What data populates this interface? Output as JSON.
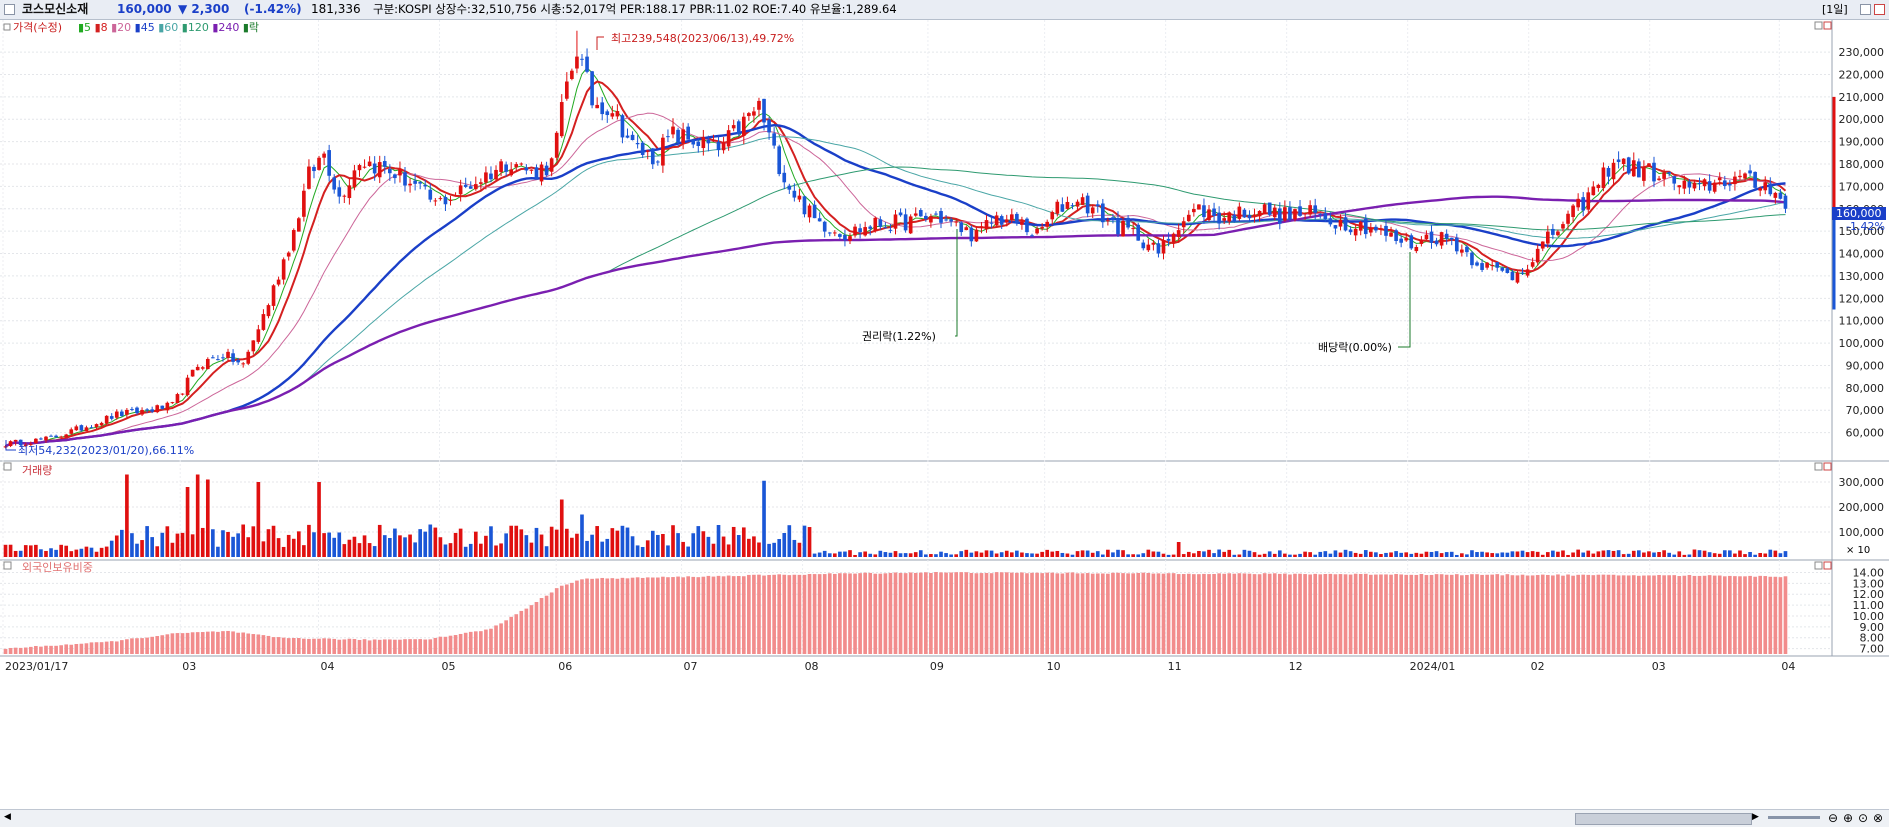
{
  "header": {
    "stock_name": "코스모신소재",
    "price": "160,000",
    "change": "▼ 2,300",
    "change_pct": "(-1.42%)",
    "volume": "181,336",
    "info": "구분:KOSPI  상장수:32,510,756  시총:52,017억  PER:188.17  PBR:11.02  ROE:7.40  유보율:1,289.64",
    "period": "[1일]"
  },
  "legend": {
    "price_label": "가격(수정)",
    "ma": [
      {
        "label": "5",
        "color": "#22aa22"
      },
      {
        "label": "8",
        "color": "#d42020"
      },
      {
        "label": "20",
        "color": "#cc6699"
      },
      {
        "label": "45",
        "color": "#1a3fc8"
      },
      {
        "label": "60",
        "color": "#4aa6a6"
      },
      {
        "label": "120",
        "color": "#2e9a70"
      },
      {
        "label": "240",
        "color": "#7a1fb0"
      }
    ],
    "extra_label": "락"
  },
  "annotations": {
    "high": "최고239,548(2023/06/13),49.72%",
    "low": "최저54,232(2023/01/20),66.11%",
    "rights": "권리락(1.22%)",
    "dividend": "배당락(0.00%)",
    "last_price": "160,000",
    "last_pct": "-1.42%"
  },
  "panels": {
    "volume_title": "거래량",
    "foreign_title": "외국인보유비중",
    "volume_unit": "× 10"
  },
  "chart_data": [
    {
      "type": "candlestick",
      "title": "가격(수정)",
      "y_ticks": [
        60000,
        70000,
        80000,
        90000,
        100000,
        110000,
        120000,
        130000,
        140000,
        150000,
        160000,
        170000,
        180000,
        190000,
        200000,
        210000,
        220000,
        230000
      ],
      "y_tick_labels": [
        "60,000",
        "70,000",
        "80,000",
        "90,000",
        "100,000",
        "110,000",
        "120,000",
        "130,000",
        "140,000",
        "150,000",
        "160,000",
        "170,000",
        "180,000",
        "190,000",
        "200,000",
        "210,000",
        "220,000",
        "230,000"
      ],
      "ylim": [
        50000,
        243000
      ],
      "x_labels": [
        "2023/01/17",
        "03",
        "04",
        "05",
        "06",
        "07",
        "08",
        "09",
        "10",
        "11",
        "12",
        "2024/01",
        "02",
        "03",
        "04"
      ],
      "ma_periods": [
        5,
        8,
        20,
        45,
        60,
        120,
        240
      ],
      "anchors": [
        [
          0,
          55000
        ],
        [
          8,
          57000
        ],
        [
          15,
          62000
        ],
        [
          22,
          68000
        ],
        [
          28,
          70000
        ],
        [
          33,
          72000
        ],
        [
          38,
          90000
        ],
        [
          43,
          95000
        ],
        [
          47,
          90000
        ],
        [
          52,
          118000
        ],
        [
          57,
          150000
        ],
        [
          60,
          175000
        ],
        [
          63,
          185000
        ],
        [
          66,
          165000
        ],
        [
          70,
          182000
        ],
        [
          75,
          178000
        ],
        [
          80,
          172000
        ],
        [
          85,
          162000
        ],
        [
          90,
          168000
        ],
        [
          95,
          175000
        ],
        [
          100,
          182000
        ],
        [
          104,
          176000
        ],
        [
          108,
          180000
        ],
        [
          111,
          215000
        ],
        [
          113,
          232000
        ],
        [
          116,
          208000
        ],
        [
          120,
          205000
        ],
        [
          124,
          188000
        ],
        [
          128,
          183000
        ],
        [
          132,
          193000
        ],
        [
          137,
          190000
        ],
        [
          141,
          186000
        ],
        [
          145,
          196000
        ],
        [
          149,
          206000
        ],
        [
          152,
          185000
        ],
        [
          155,
          170000
        ],
        [
          160,
          155000
        ],
        [
          166,
          149000
        ],
        [
          172,
          153000
        ],
        [
          178,
          154000
        ],
        [
          184,
          157000
        ],
        [
          188,
          152000
        ],
        [
          192,
          148000
        ],
        [
          196,
          156000
        ],
        [
          200,
          154000
        ],
        [
          204,
          148000
        ],
        [
          208,
          160000
        ],
        [
          212,
          165000
        ],
        [
          216,
          158000
        ],
        [
          220,
          152000
        ],
        [
          224,
          148000
        ],
        [
          228,
          140000
        ],
        [
          232,
          154000
        ],
        [
          236,
          160000
        ],
        [
          240,
          156000
        ],
        [
          244,
          158000
        ],
        [
          248,
          160000
        ],
        [
          252,
          157000
        ],
        [
          258,
          158000
        ],
        [
          264,
          154000
        ],
        [
          270,
          152000
        ],
        [
          274,
          147000
        ],
        [
          278,
          144000
        ],
        [
          282,
          148000
        ],
        [
          286,
          146000
        ],
        [
          290,
          138000
        ],
        [
          294,
          133000
        ],
        [
          298,
          130000
        ],
        [
          302,
          138000
        ],
        [
          306,
          149000
        ],
        [
          310,
          158000
        ],
        [
          314,
          168000
        ],
        [
          318,
          182000
        ],
        [
          322,
          178000
        ],
        [
          326,
          176000
        ],
        [
          330,
          172000
        ],
        [
          334,
          168000
        ],
        [
          338,
          172000
        ],
        [
          342,
          174000
        ],
        [
          346,
          171000
        ],
        [
          350,
          170000
        ],
        [
          352,
          160000
        ]
      ],
      "candle_count": 353,
      "high": 239548,
      "low": 54232,
      "last": 160000
    },
    {
      "type": "bar",
      "title": "거래량",
      "y_tick_labels": [
        "100,000",
        "200,000",
        "300,000"
      ],
      "y_ticks": [
        100000,
        200000,
        300000
      ],
      "ylim": [
        0,
        340000
      ],
      "spikes": [
        [
          24,
          330000
        ],
        [
          36,
          280000
        ],
        [
          38,
          330000
        ],
        [
          40,
          310000
        ],
        [
          50,
          300000
        ],
        [
          62,
          300000
        ],
        [
          110,
          230000
        ],
        [
          114,
          170000
        ],
        [
          150,
          305000
        ],
        [
          232,
          60000
        ]
      ]
    },
    {
      "type": "bar",
      "title": "외국인보유비중",
      "y_tick_labels": [
        "7.00",
        "8.00",
        "9.00",
        "10.00",
        "11.00",
        "12.00",
        "13.00",
        "14.00"
      ],
      "y_ticks": [
        7,
        8,
        9,
        10,
        11,
        12,
        13,
        14
      ],
      "ylim": [
        6.5,
        14.5
      ],
      "anchors": [
        [
          0,
          7.0
        ],
        [
          20,
          7.6
        ],
        [
          34,
          8.4
        ],
        [
          44,
          8.6
        ],
        [
          54,
          8.0
        ],
        [
          72,
          7.8
        ],
        [
          84,
          7.9
        ],
        [
          96,
          8.8
        ],
        [
          104,
          11.0
        ],
        [
          110,
          12.8
        ],
        [
          114,
          13.4
        ],
        [
          166,
          13.9
        ],
        [
          182,
          14.0
        ],
        [
          340,
          13.7
        ],
        [
          352,
          13.6
        ]
      ]
    }
  ]
}
